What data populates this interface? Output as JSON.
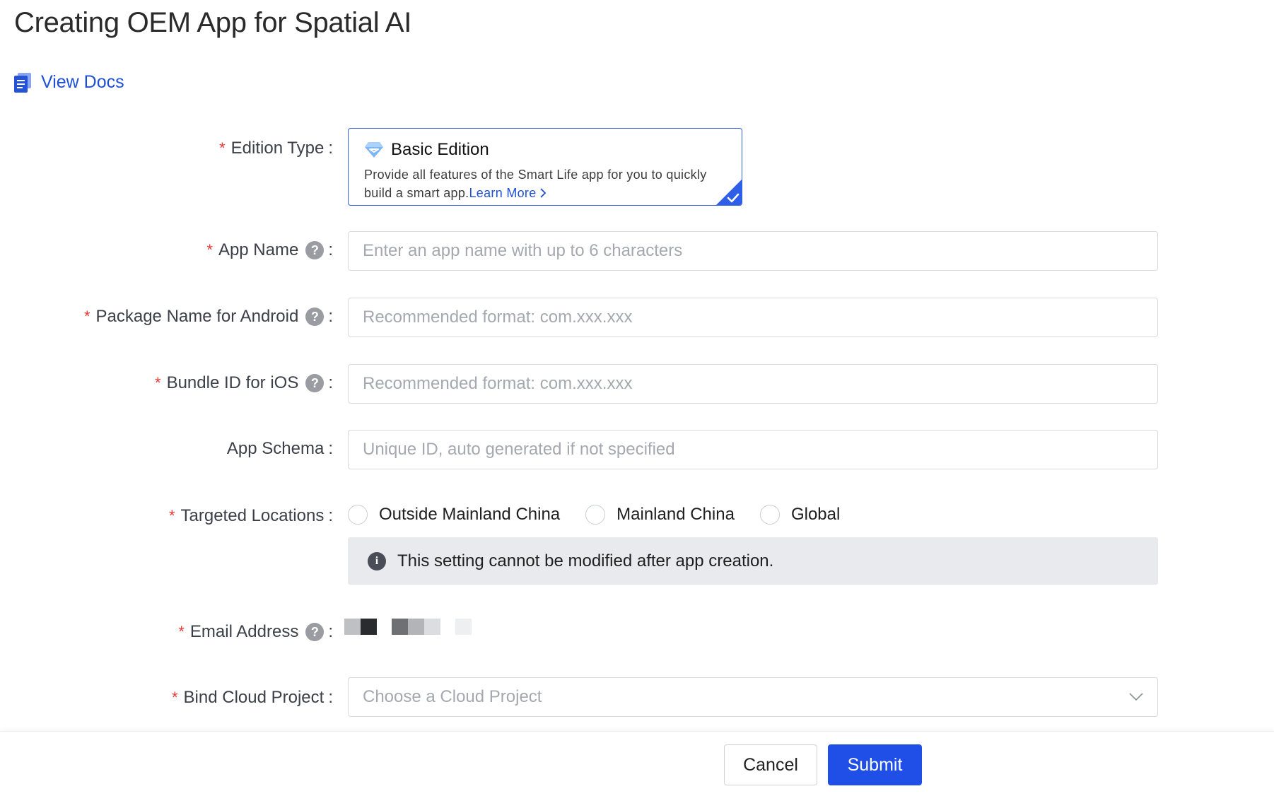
{
  "page": {
    "title": "Creating OEM App for Spatial AI"
  },
  "docs": {
    "label": "View Docs"
  },
  "form": {
    "edition": {
      "label": "Edition Type",
      "title": "Basic Edition",
      "description": "Provide all features of the Smart Life app for you to quickly build a smart app.",
      "learn_more": "Learn More",
      "selected": true
    },
    "app_name": {
      "label": "App Name",
      "placeholder": "Enter an app name with up to 6 characters",
      "value": ""
    },
    "android_package": {
      "label": "Package Name for Android",
      "placeholder": "Recommended format: com.xxx.xxx",
      "value": ""
    },
    "ios_bundle": {
      "label": "Bundle ID for iOS",
      "placeholder": "Recommended format: com.xxx.xxx",
      "value": ""
    },
    "app_schema": {
      "label": "App Schema",
      "placeholder": "Unique ID, auto generated if not specified",
      "value": ""
    },
    "locations": {
      "label": "Targeted Locations",
      "options": [
        "Outside Mainland China",
        "Mainland China",
        "Global"
      ],
      "selected": null,
      "notice": "This setting cannot be modified after app creation."
    },
    "email": {
      "label": "Email Address",
      "value_redacted": true
    },
    "cloud_project": {
      "label": "Bind Cloud Project",
      "placeholder": "Choose a Cloud Project"
    }
  },
  "footer": {
    "cancel_label": "Cancel",
    "submit_label": "Submit"
  },
  "colors": {
    "accent": "#1f4fe6",
    "required": "#e53935",
    "link": "#1e4fd8",
    "notice_bg": "#e9eaed"
  },
  "icons": {
    "docs": "document-icon",
    "edition": "diamond-icon",
    "help": "question-mark-icon",
    "info": "info-icon",
    "select": "chevron-down-icon",
    "selected_corner": "checkmark-icon"
  }
}
